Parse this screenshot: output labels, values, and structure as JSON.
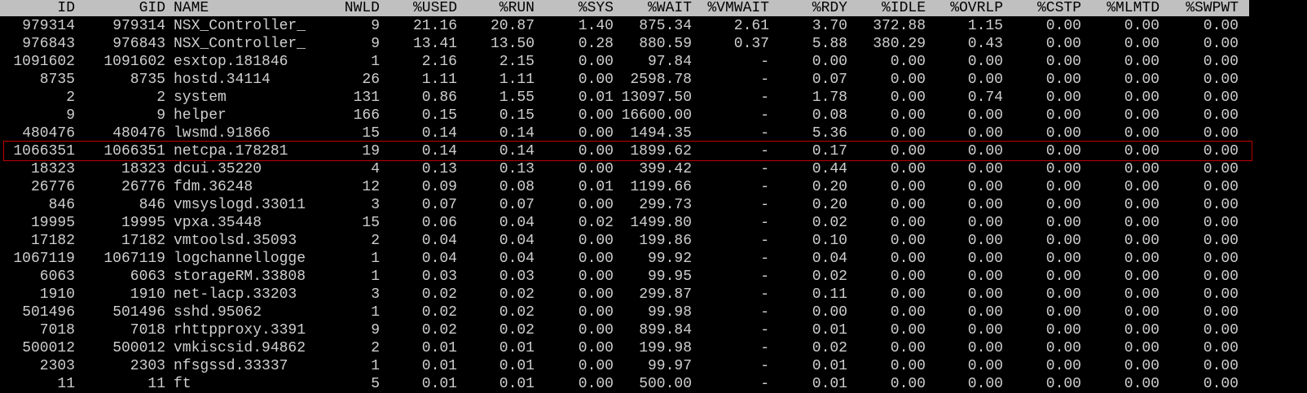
{
  "colors": {
    "background": "#000000",
    "text": "#cfcfcf",
    "header_background": "#c0c0c0",
    "header_text": "#000000",
    "highlight_border": "#c00000"
  },
  "columns": [
    "ID",
    "GID",
    "NAME",
    "NWLD",
    "%USED",
    "%RUN",
    "%SYS",
    "%WAIT",
    "%VMWAIT",
    "%RDY",
    "%IDLE",
    "%OVRLP",
    "%CSTP",
    "%MLMTD",
    "%SWPWT"
  ],
  "highlighted_row_index": 7,
  "rows": [
    [
      "979314",
      "979314",
      "NSX_Controller_",
      "9",
      "21.16",
      "20.87",
      "1.40",
      "875.34",
      "2.61",
      "3.70",
      "372.88",
      "1.15",
      "0.00",
      "0.00",
      "0.00"
    ],
    [
      "976843",
      "976843",
      "NSX_Controller_",
      "9",
      "13.41",
      "13.50",
      "0.28",
      "880.59",
      "0.37",
      "5.88",
      "380.29",
      "0.43",
      "0.00",
      "0.00",
      "0.00"
    ],
    [
      "1091602",
      "1091602",
      "esxtop.181846",
      "1",
      "2.16",
      "2.15",
      "0.00",
      "97.84",
      "-",
      "0.00",
      "0.00",
      "0.00",
      "0.00",
      "0.00",
      "0.00"
    ],
    [
      "8735",
      "8735",
      "hostd.34114",
      "26",
      "1.11",
      "1.11",
      "0.00",
      "2598.78",
      "-",
      "0.07",
      "0.00",
      "0.00",
      "0.00",
      "0.00",
      "0.00"
    ],
    [
      "2",
      "2",
      "system",
      "131",
      "0.86",
      "1.55",
      "0.01",
      "13097.50",
      "-",
      "1.78",
      "0.00",
      "0.74",
      "0.00",
      "0.00",
      "0.00"
    ],
    [
      "9",
      "9",
      "helper",
      "166",
      "0.15",
      "0.15",
      "0.00",
      "16600.00",
      "-",
      "0.08",
      "0.00",
      "0.00",
      "0.00",
      "0.00",
      "0.00"
    ],
    [
      "480476",
      "480476",
      "lwsmd.91866",
      "15",
      "0.14",
      "0.14",
      "0.00",
      "1494.35",
      "-",
      "5.36",
      "0.00",
      "0.00",
      "0.00",
      "0.00",
      "0.00"
    ],
    [
      "1066351",
      "1066351",
      "netcpa.178281",
      "19",
      "0.14",
      "0.14",
      "0.00",
      "1899.62",
      "-",
      "0.17",
      "0.00",
      "0.00",
      "0.00",
      "0.00",
      "0.00"
    ],
    [
      "18323",
      "18323",
      "dcui.35220",
      "4",
      "0.13",
      "0.13",
      "0.00",
      "399.42",
      "-",
      "0.44",
      "0.00",
      "0.00",
      "0.00",
      "0.00",
      "0.00"
    ],
    [
      "26776",
      "26776",
      "fdm.36248",
      "12",
      "0.09",
      "0.08",
      "0.01",
      "1199.66",
      "-",
      "0.20",
      "0.00",
      "0.00",
      "0.00",
      "0.00",
      "0.00"
    ],
    [
      "846",
      "846",
      "vmsyslogd.33011",
      "3",
      "0.07",
      "0.07",
      "0.00",
      "299.73",
      "-",
      "0.20",
      "0.00",
      "0.00",
      "0.00",
      "0.00",
      "0.00"
    ],
    [
      "19995",
      "19995",
      "vpxa.35448",
      "15",
      "0.06",
      "0.04",
      "0.02",
      "1499.80",
      "-",
      "0.02",
      "0.00",
      "0.00",
      "0.00",
      "0.00",
      "0.00"
    ],
    [
      "17182",
      "17182",
      "vmtoolsd.35093",
      "2",
      "0.04",
      "0.04",
      "0.00",
      "199.86",
      "-",
      "0.10",
      "0.00",
      "0.00",
      "0.00",
      "0.00",
      "0.00"
    ],
    [
      "1067119",
      "1067119",
      "logchannellogge",
      "1",
      "0.04",
      "0.04",
      "0.00",
      "99.92",
      "-",
      "0.04",
      "0.00",
      "0.00",
      "0.00",
      "0.00",
      "0.00"
    ],
    [
      "6063",
      "6063",
      "storageRM.33808",
      "1",
      "0.03",
      "0.03",
      "0.00",
      "99.95",
      "-",
      "0.02",
      "0.00",
      "0.00",
      "0.00",
      "0.00",
      "0.00"
    ],
    [
      "1910",
      "1910",
      "net-lacp.33203",
      "3",
      "0.02",
      "0.02",
      "0.00",
      "299.87",
      "-",
      "0.11",
      "0.00",
      "0.00",
      "0.00",
      "0.00",
      "0.00"
    ],
    [
      "501496",
      "501496",
      "sshd.95062",
      "1",
      "0.02",
      "0.02",
      "0.00",
      "99.98",
      "-",
      "0.00",
      "0.00",
      "0.00",
      "0.00",
      "0.00",
      "0.00"
    ],
    [
      "7018",
      "7018",
      "rhttpproxy.3391",
      "9",
      "0.02",
      "0.02",
      "0.00",
      "899.84",
      "-",
      "0.01",
      "0.00",
      "0.00",
      "0.00",
      "0.00",
      "0.00"
    ],
    [
      "500012",
      "500012",
      "vmkiscsid.94862",
      "2",
      "0.01",
      "0.01",
      "0.00",
      "199.98",
      "-",
      "0.02",
      "0.00",
      "0.00",
      "0.00",
      "0.00",
      "0.00"
    ],
    [
      "2303",
      "2303",
      "nfsgssd.33337",
      "1",
      "0.01",
      "0.01",
      "0.00",
      "99.97",
      "-",
      "0.01",
      "0.00",
      "0.00",
      "0.00",
      "0.00",
      "0.00"
    ],
    [
      "11",
      "11",
      "ft",
      "5",
      "0.01",
      "0.01",
      "0.00",
      "500.00",
      "-",
      "0.01",
      "0.00",
      "0.00",
      "0.00",
      "0.00",
      "0.00"
    ]
  ]
}
